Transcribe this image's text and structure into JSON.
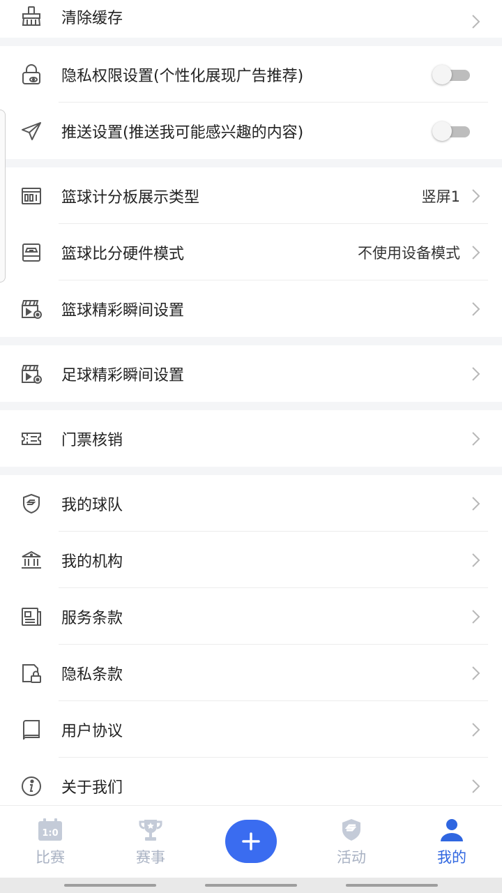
{
  "settings": {
    "clear_cache": "清除缓存",
    "privacy_permission": "隐私权限设置(个性化展现广告推荐)",
    "push_settings": "推送设置(推送我可能感兴趣的内容)",
    "basketball_scoreboard": "篮球计分板展示类型",
    "basketball_scoreboard_value": "竖屏1",
    "basketball_hardware": "篮球比分硬件模式",
    "basketball_hardware_value": "不使用设备模式",
    "basketball_highlights": "篮球精彩瞬间设置",
    "football_highlights": "足球精彩瞬间设置",
    "ticket_verify": "门票核销",
    "my_team": "我的球队",
    "my_org": "我的机构",
    "terms_service": "服务条款",
    "privacy_terms": "隐私条款",
    "user_agreement": "用户协议",
    "about_us": "关于我们"
  },
  "toggles": {
    "privacy_permission": false,
    "push_settings": false
  },
  "tabbar": {
    "match": "比赛",
    "match_icon_text": "1:0",
    "event": "赛事",
    "activity": "活动",
    "mine": "我的"
  },
  "colors": {
    "accent": "#2f66e0",
    "inactive": "#a9b2c3",
    "fab": "#3a6cf0"
  },
  "icons": {
    "clear_cache": "broom-icon",
    "privacy": "lock-eye-icon",
    "push": "paper-plane-icon",
    "scoreboard": "scoreboard-icon",
    "hardware": "device-icon",
    "highlights": "clapperboard-icon",
    "ticket": "ticket-icon",
    "team": "shield-s-icon",
    "org": "building-icon",
    "terms": "document-icon",
    "privacy_terms": "doc-lock-icon",
    "agreement": "book-icon",
    "about": "info-icon"
  }
}
